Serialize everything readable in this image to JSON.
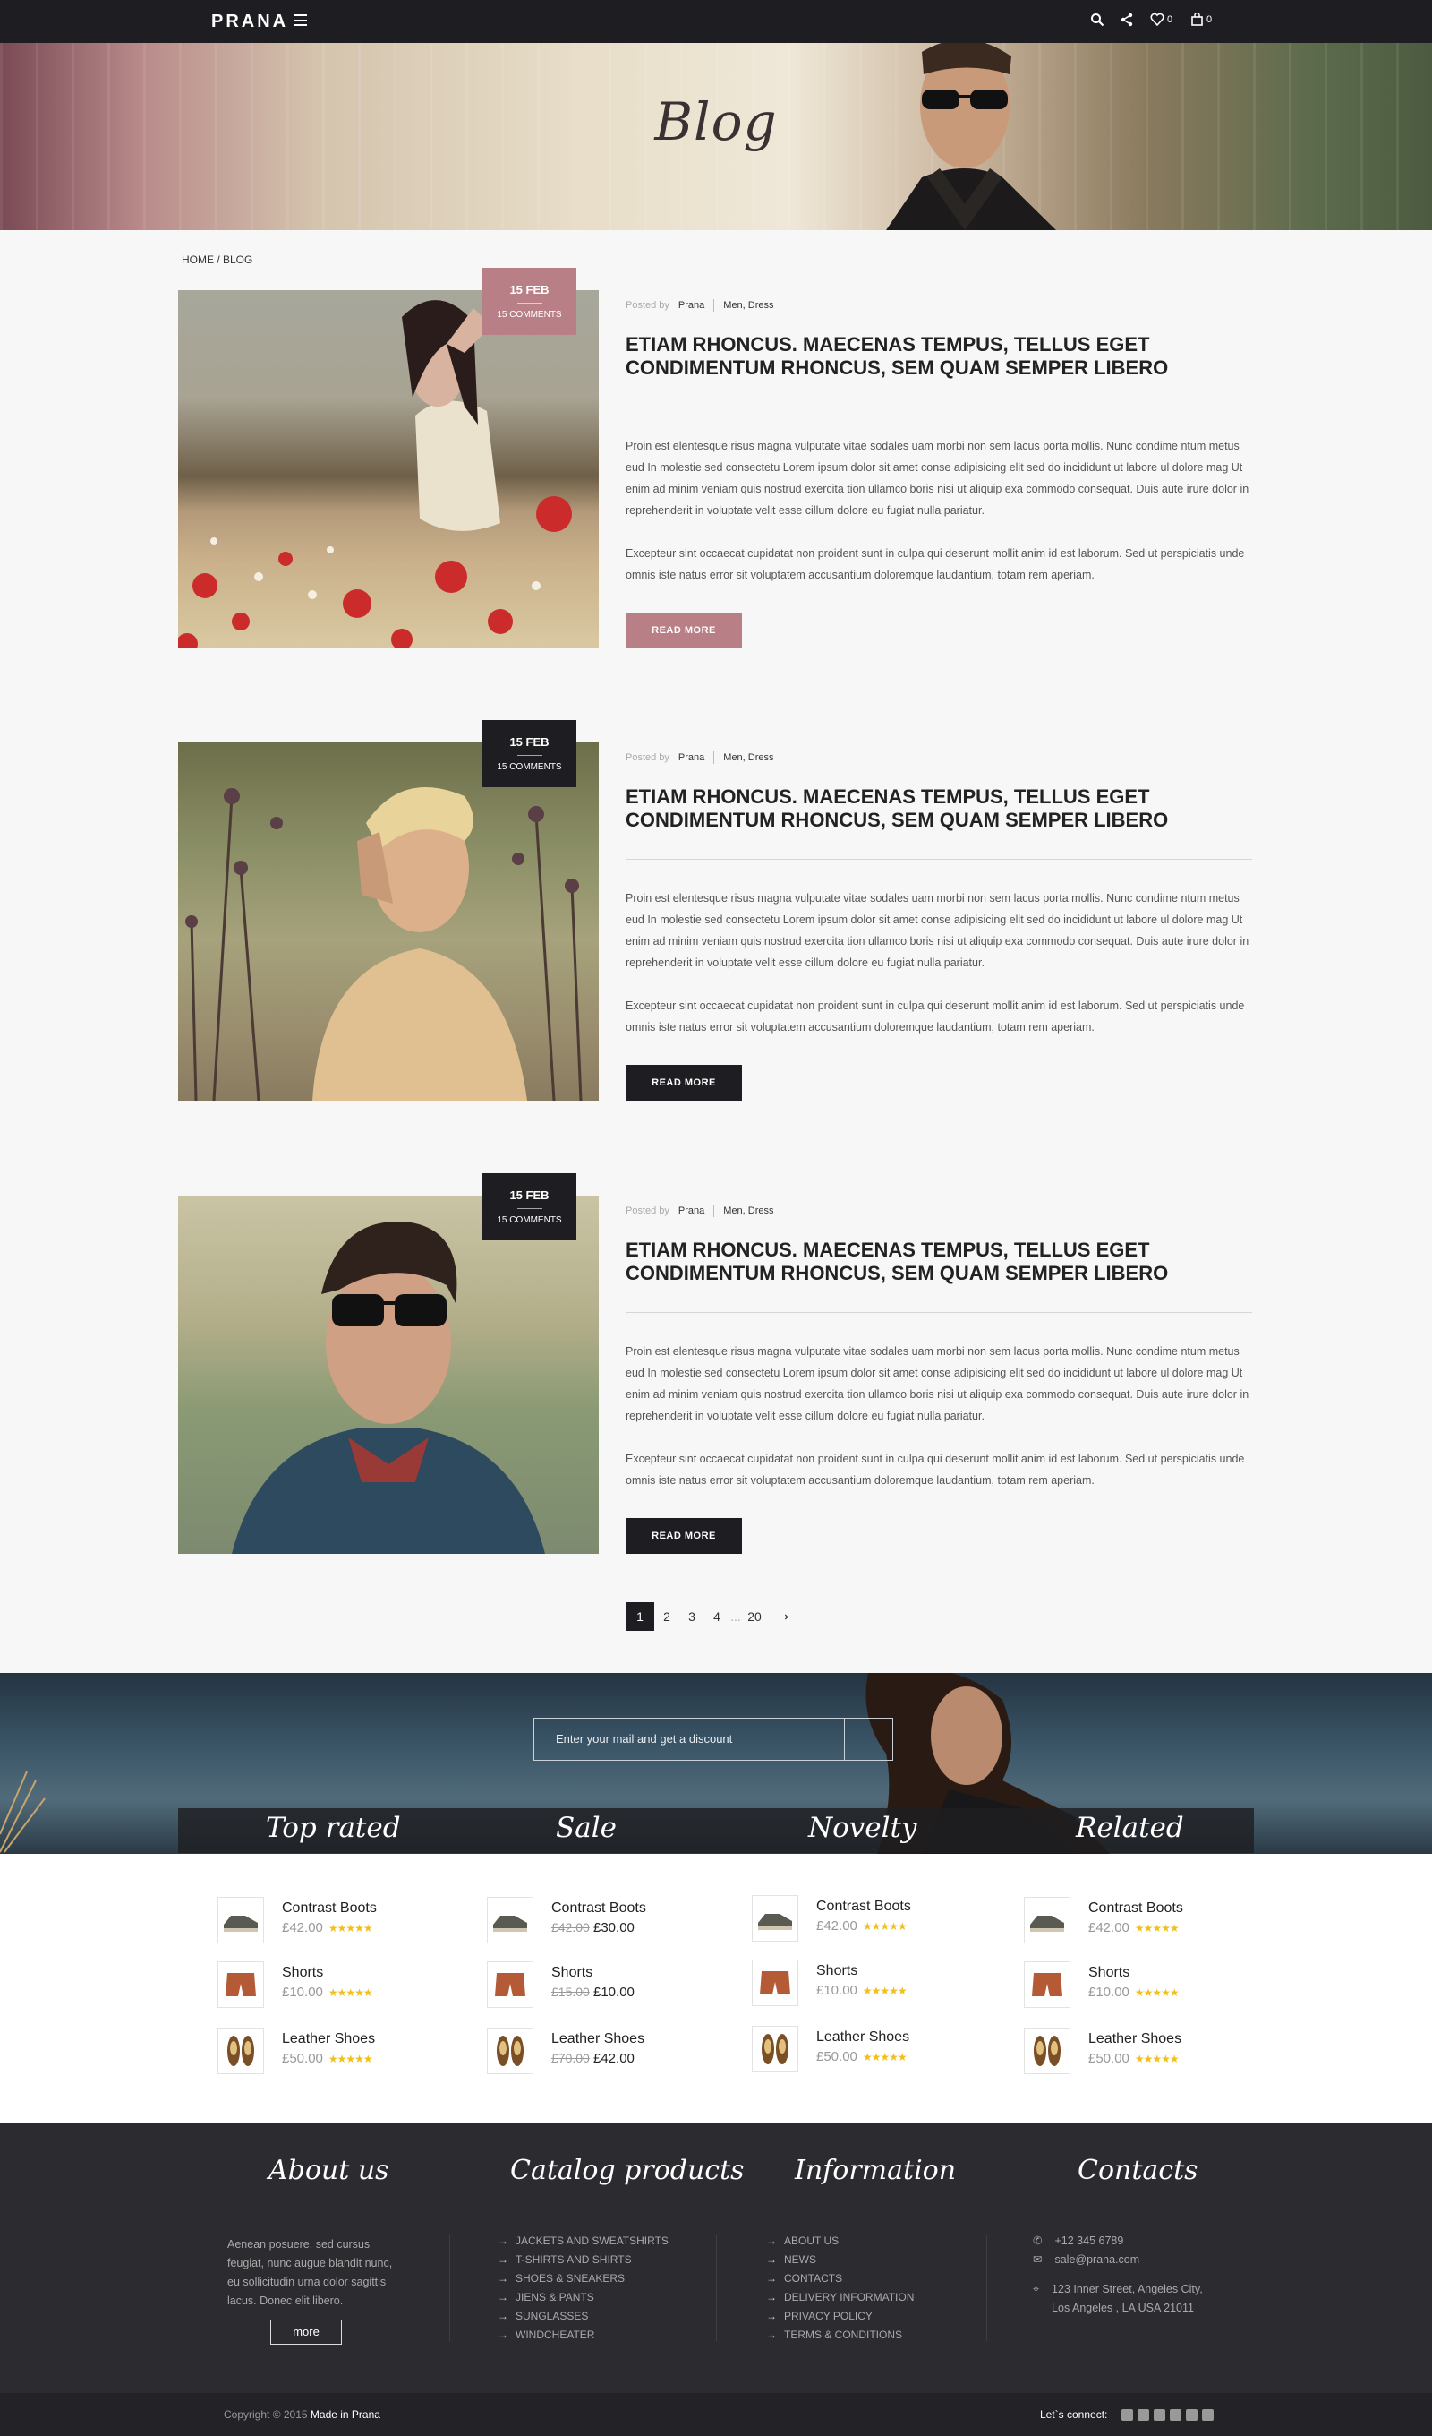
{
  "header": {
    "logo": "PRANA",
    "wishlist_count": "0",
    "cart_count": "0"
  },
  "hero": {
    "title": "Blog"
  },
  "breadcrumb": "HOME / BLOG",
  "posts": [
    {
      "date": "15 FEB",
      "comments": "15 COMMENTS",
      "posted_by_label": "Posted by",
      "author": "Prana",
      "categories": "Men, Dress",
      "title": "ETIAM RHONCUS. MAECENAS TEMPUS, TELLUS EGET CONDIMENTUM RHONCUS, SEM QUAM SEMPER LIBERO",
      "p1": "Proin est elentesque risus magna vulputate vitae sodales uam morbi non sem lacus porta mollis. Nunc condime ntum metus eud In molestie sed consectetu Lorem ipsum dolor sit amet conse adipisicing elit sed do incididunt ut labore ul dolore mag Ut enim ad minim veniam quis nostrud exercita tion ullamco boris nisi ut aliquip exa commodo consequat. Duis aute irure dolor in reprehenderit in voluptate velit esse cillum dolore eu fugiat nulla pariatur.",
      "p2": "Excepteur sint occaecat cupidatat non proident sunt in culpa qui deserunt mollit anim id est laborum. Sed ut perspiciatis unde omnis iste natus error sit voluptatem accusantium doloremque laudantium, totam rem aperiam.",
      "button": "READ MORE"
    },
    {
      "date": "15 FEB",
      "comments": "15 COMMENTS",
      "posted_by_label": "Posted by",
      "author": "Prana",
      "categories": "Men, Dress",
      "title": "ETIAM RHONCUS. MAECENAS TEMPUS, TELLUS EGET CONDIMENTUM RHONCUS, SEM QUAM SEMPER LIBERO",
      "p1": "Proin est elentesque risus magna vulputate vitae sodales uam morbi non sem lacus porta mollis. Nunc condime ntum metus eud In molestie sed consectetu Lorem ipsum dolor sit amet conse adipisicing elit sed do incididunt ut labore ul dolore mag Ut enim ad minim veniam quis nostrud exercita tion ullamco boris nisi ut aliquip exa commodo consequat. Duis aute irure dolor in reprehenderit in voluptate velit esse cillum dolore eu fugiat nulla pariatur.",
      "p2": "Excepteur sint occaecat cupidatat non proident sunt in culpa qui deserunt mollit anim id est laborum. Sed ut perspiciatis unde omnis iste natus error sit voluptatem accusantium doloremque laudantium, totam rem aperiam.",
      "button": "READ MORE"
    },
    {
      "date": "15 FEB",
      "comments": "15 COMMENTS",
      "posted_by_label": "Posted by",
      "author": "Prana",
      "categories": "Men, Dress",
      "title": "ETIAM RHONCUS. MAECENAS TEMPUS, TELLUS EGET CONDIMENTUM RHONCUS, SEM QUAM SEMPER LIBERO",
      "p1": "Proin est elentesque risus magna vulputate vitae sodales uam morbi non sem lacus porta mollis. Nunc condime ntum metus eud In molestie sed consectetu Lorem ipsum dolor sit amet conse adipisicing elit sed do incididunt ut labore ul dolore mag Ut enim ad minim veniam quis nostrud exercita tion ullamco boris nisi ut aliquip exa commodo consequat. Duis aute irure dolor in reprehenderit in voluptate velit esse cillum dolore eu fugiat nulla pariatur.",
      "p2": "Excepteur sint occaecat cupidatat non proident sunt in culpa qui deserunt mollit anim id est laborum. Sed ut perspiciatis unde omnis iste natus error sit voluptatem accusantium doloremque laudantium, totam rem aperiam.",
      "button": "READ MORE"
    }
  ],
  "pagination": {
    "p1": "1",
    "p2": "2",
    "p3": "3",
    "p4": "4",
    "dots": "...",
    "last": "20"
  },
  "newsletter": {
    "placeholder": "Enter your mail and get a discount"
  },
  "product_tabs": [
    "Top rated",
    "Sale",
    "Novelty",
    "Related"
  ],
  "products": {
    "col1": [
      {
        "name": "Contrast Boots",
        "price": "£42.00",
        "stars": "★★★★★"
      },
      {
        "name": "Shorts",
        "price": "£10.00",
        "stars": "★★★★★"
      },
      {
        "name": "Leather Shoes",
        "price": "£50.00",
        "stars": "★★★★★"
      }
    ],
    "col2": [
      {
        "name": "Contrast Boots",
        "old": "£42.00",
        "new": "£30.00"
      },
      {
        "name": "Shorts",
        "old": "£15.00",
        "new": "£10.00"
      },
      {
        "name": "Leather Shoes",
        "old": "£70.00",
        "new": "£42.00"
      }
    ],
    "col3": [
      {
        "name": "Contrast Boots",
        "price": "£42.00",
        "stars": "★★★★★"
      },
      {
        "name": "Shorts",
        "price": "£10.00",
        "stars": "★★★★★"
      },
      {
        "name": "Leather Shoes",
        "price": "£50.00",
        "stars": "★★★★★"
      }
    ],
    "col4": [
      {
        "name": "Contrast Boots",
        "price": "£42.00",
        "stars": "★★★★★"
      },
      {
        "name": "Shorts",
        "price": "£10.00",
        "stars": "★★★★★"
      },
      {
        "name": "Leather Shoes",
        "price": "£50.00",
        "stars": "★★★★★"
      }
    ]
  },
  "footer": {
    "about_title": "About us",
    "about_text": "Aenean posuere, sed cursus feugiat, nunc augue blandit nunc, eu sollicitudin urna dolor sagittis lacus. Donec elit libero.",
    "about_more": "more",
    "catalog_title": "Catalog products",
    "catalog": [
      "JACKETS AND SWEATSHIRTS",
      "T-SHIRTS AND SHIRTS",
      "SHOES & SNEAKERS",
      "JIENS & PANTS",
      "SUNGLASSES",
      "WINDCHEATER"
    ],
    "info_title": "Information",
    "info": [
      "ABOUT US",
      "NEWS",
      "CONTACTS",
      "DELIVERY INFORMATION",
      "PRIVACY POLICY",
      "TERMS & CONDITIONS"
    ],
    "contacts_title": "Contacts",
    "phone": "+12 345 6789",
    "email": "sale@prana.com",
    "address1": "123 Inner Street, Angeles City,",
    "address2": "Los Angeles , LA USA 21011"
  },
  "bottom": {
    "copyright": "Copyright © 2015",
    "made_in": "Made in Prana",
    "connect": "Let`s connect:"
  },
  "colors": {
    "accent": "#b87f86",
    "dark": "#1e1e22",
    "star": "#f0c020"
  }
}
